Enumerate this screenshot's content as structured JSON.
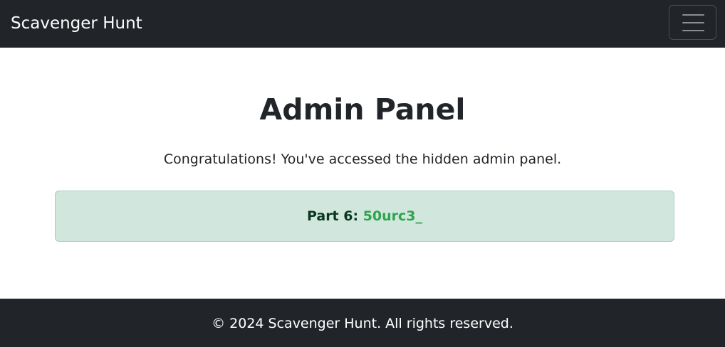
{
  "navbar": {
    "brand": "Scavenger Hunt",
    "toggler_icon": "hamburger-menu-icon"
  },
  "main": {
    "title": "Admin Panel",
    "message": "Congratulations! You've accessed the hidden admin panel.",
    "alert": {
      "label": "Part 6:",
      "code": "50urc3_",
      "background_color": "#d1e7dd",
      "code_color": "#2ea44f"
    }
  },
  "footer": {
    "text": "© 2024 Scavenger Hunt. All rights reserved."
  },
  "colors": {
    "navbar_bg": "#212529",
    "footer_bg": "#212529"
  }
}
